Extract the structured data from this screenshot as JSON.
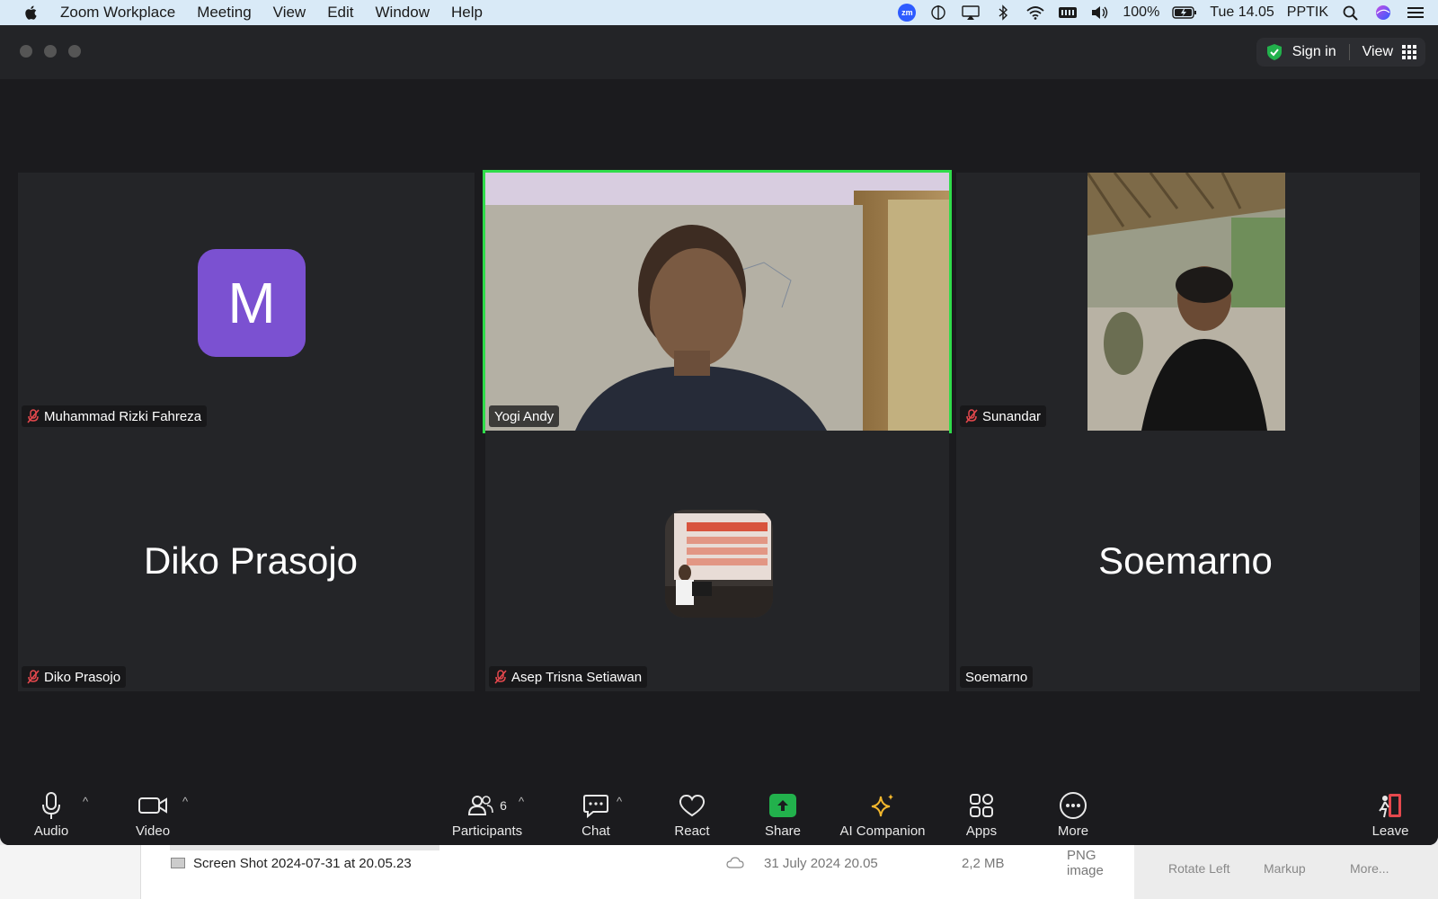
{
  "menubar": {
    "app_name": "Zoom Workplace",
    "items": [
      "Meeting",
      "View",
      "Edit",
      "Window",
      "Help"
    ],
    "battery": "100%",
    "clock": "Tue 14.05",
    "user": "PPTIK",
    "zm_badge": "zm"
  },
  "window": {
    "sign_in": "Sign in",
    "view": "View"
  },
  "participants": [
    {
      "name": "Muhammad Rizki Fahreza",
      "muted": true,
      "avatar_letter": "M",
      "avatar_color": "#7b51d1"
    },
    {
      "name": "Yogi Andy",
      "muted": false,
      "active_speaker": true
    },
    {
      "name": "Sunandar",
      "muted": true
    },
    {
      "name": "Diko Prasojo",
      "muted": true,
      "display_name": "Diko Prasojo"
    },
    {
      "name": "Asep Trisna Setiawan",
      "muted": true
    },
    {
      "name": "Soemarno",
      "muted": false,
      "display_name": "Soemarno"
    }
  ],
  "toolbar": {
    "audio": "Audio",
    "video": "Video",
    "participants": "Participants",
    "participants_count": "6",
    "chat": "Chat",
    "react": "React",
    "share": "Share",
    "ai_companion": "AI Companion",
    "apps": "Apps",
    "more": "More",
    "leave": "Leave"
  },
  "finder": {
    "rows": [
      {
        "name": "Screen Shot 2024-07-31 at 20.05.23",
        "date": "31 July 2024 20.05",
        "size": "2,2 MB",
        "kind": "PNG image"
      }
    ],
    "actions": [
      "Rotate Left",
      "Markup",
      "More..."
    ]
  },
  "colors": {
    "active_speaker_border": "#2fdc4a",
    "share_green": "#22b14c",
    "mute_red": "#e5484d",
    "leave_red": "#e5484d"
  }
}
